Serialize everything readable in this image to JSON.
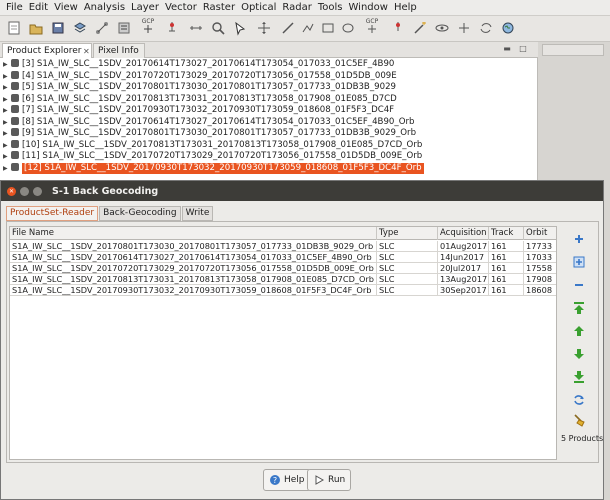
{
  "menubar": {
    "items": [
      "File",
      "Edit",
      "View",
      "Analysis",
      "Layer",
      "Vector",
      "Raster",
      "Optical",
      "Radar",
      "Tools",
      "Window",
      "Help"
    ]
  },
  "toolbar": {
    "gcp_label": "GCP"
  },
  "explorer": {
    "tabs": [
      "Product Explorer",
      "Pixel Info"
    ],
    "products": [
      {
        "label": "[3] S1A_IW_SLC__1SDV_20170614T173027_20170614T173054_017033_01C5EF_4B90",
        "selected": false
      },
      {
        "label": "[4] S1A_IW_SLC__1SDV_20170720T173029_20170720T173056_017558_01D5DB_009E",
        "selected": false
      },
      {
        "label": "[5] S1A_IW_SLC__1SDV_20170801T173030_20170801T173057_017733_01DB3B_9029",
        "selected": false
      },
      {
        "label": "[6] S1A_IW_SLC__1SDV_20170813T173031_20170813T173058_017908_01E085_D7CD",
        "selected": false
      },
      {
        "label": "[7] S1A_IW_SLC__1SDV_20170930T173032_20170930T173059_018608_01F5F3_DC4F",
        "selected": false
      },
      {
        "label": "[8] S1A_IW_SLC__1SDV_20170614T173027_20170614T173054_017033_01C5EF_4B90_Orb",
        "selected": false
      },
      {
        "label": "[9] S1A_IW_SLC__1SDV_20170801T173030_20170801T173057_017733_01DB3B_9029_Orb",
        "selected": false
      },
      {
        "label": "[10] S1A_IW_SLC__1SDV_20170813T173031_20170813T173058_017908_01E085_D7CD_Orb",
        "selected": false
      },
      {
        "label": "[11] S1A_IW_SLC__1SDV_20170720T173029_20170720T173056_017558_01D5DB_009E_Orb",
        "selected": false
      },
      {
        "label": "[12] S1A_IW_SLC__1SDV_20170930T173032_20170930T173059_018608_01F5F3_DC4F_Orb",
        "selected": true
      }
    ]
  },
  "dialog": {
    "title": "S-1 Back Geocoding",
    "tabs": [
      "ProductSet-Reader",
      "Back-Geocoding",
      "Write"
    ],
    "columns": [
      "File Name",
      "Type",
      "Acquisition",
      "Track",
      "Orbit"
    ],
    "rows": [
      [
        "S1A_IW_SLC__1SDV_20170801T173030_20170801T173057_017733_01DB3B_9029_Orb",
        "SLC",
        "01Aug2017",
        "161",
        "17733"
      ],
      [
        "S1A_IW_SLC__1SDV_20170614T173027_20170614T173054_017033_01C5EF_4B90_Orb",
        "SLC",
        "14Jun2017",
        "161",
        "17033"
      ],
      [
        "S1A_IW_SLC__1SDV_20170720T173029_20170720T173056_017558_01D5DB_009E_Orb",
        "SLC",
        "20Jul2017",
        "161",
        "17558"
      ],
      [
        "S1A_IW_SLC__1SDV_20170813T173031_20170813T173058_017908_01E085_D7CD_Orb",
        "SLC",
        "13Aug2017",
        "161",
        "17908"
      ],
      [
        "S1A_IW_SLC__1SDV_20170930T173032_20170930T173059_018608_01F5F3_DC4F_Orb",
        "SLC",
        "30Sep2017",
        "161",
        "18608"
      ]
    ],
    "product_count": "5 Products",
    "help_label": "Help",
    "run_label": "Run"
  },
  "colors": {
    "accent": "#e95420",
    "title_bar": "#3d3c38",
    "add_icon": "#3a78c8",
    "move_icon": "#3aa030"
  }
}
